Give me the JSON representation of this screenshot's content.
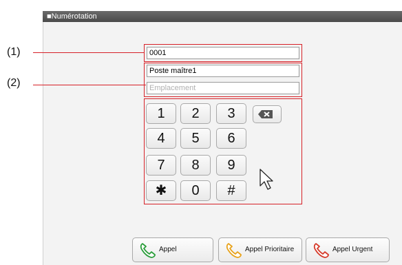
{
  "header": {
    "title": "■Numérotation"
  },
  "callouts": {
    "one": "(1)",
    "two": "(2)"
  },
  "fields": {
    "number": {
      "value": "0001"
    },
    "name": {
      "value": "Poste maître1"
    },
    "location": {
      "placeholder": "Emplacement"
    }
  },
  "keypad": {
    "keys": [
      "1",
      "2",
      "3",
      "4",
      "5",
      "6",
      "7",
      "8",
      "9",
      "✱",
      "0",
      "#"
    ],
    "backspace_icon": "backspace-icon"
  },
  "buttons": {
    "call": {
      "label": "Appel",
      "icon": "phone-icon",
      "color": "#2a9d3a"
    },
    "priority_call": {
      "label": "Appel Prioritaire",
      "icon": "phone-icon",
      "color": "#e8a21a"
    },
    "urgent_call": {
      "label": "Appel Urgent",
      "icon": "phone-icon",
      "color": "#d63a2a"
    }
  },
  "colors": {
    "callout": "#d61f26",
    "title_bar": "#555555"
  }
}
